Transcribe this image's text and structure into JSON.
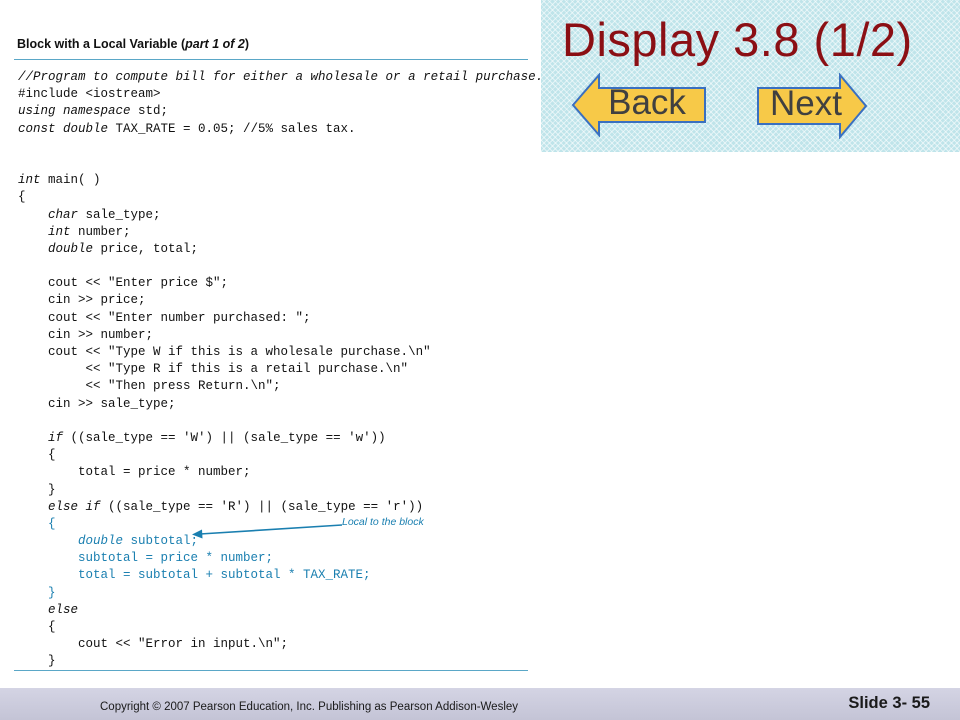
{
  "slide": {
    "title": "Display 3.8  (1/2)",
    "back_label": "Back",
    "next_label": "Next"
  },
  "panel": {
    "title": "Block with a Local Variable (",
    "title_part": "part 1 of 2",
    "title_close": ")"
  },
  "code": {
    "line01": "//Program to compute bill for either a wholesale or a retail purchase.",
    "line02": "#include <iostream>",
    "line03_kw": "using namespace",
    "line03_rest": " std;",
    "line04_kw": "const double",
    "line04_rest": " TAX_RATE = 0.05; //5% sales tax.",
    "line05": "",
    "line06": "",
    "line07_kw": "int",
    "line07_rest": " main( )",
    "line08": "{",
    "line09_pre": "    ",
    "line09_kw": "char",
    "line09_rest": " sale_type;",
    "line10_pre": "    ",
    "line10_kw": "int",
    "line10_rest": " number;",
    "line11_pre": "    ",
    "line11_kw": "double",
    "line11_rest": " price, total;",
    "line12": "",
    "line13": "    cout << \"Enter price $\";",
    "line14": "    cin >> price;",
    "line15": "    cout << \"Enter number purchased: \";",
    "line16": "    cin >> number;",
    "line17": "    cout << \"Type W if this is a wholesale purchase.\\n\"",
    "line18": "         << \"Type R if this is a retail purchase.\\n\"",
    "line19": "         << \"Then press Return.\\n\";",
    "line20": "    cin >> sale_type;",
    "line21": "",
    "line22_pre": "    ",
    "line22_kw": "if",
    "line22_rest": " ((sale_type == 'W') || (sale_type == 'w'))",
    "line23": "    {",
    "line24": "        total = price * number;",
    "line25": "    }",
    "line26_pre": "    ",
    "line26_kw": "else if",
    "line26_rest": " ((sale_type == 'R') || (sale_type == 'r'))",
    "line27": "    {",
    "line28_pre": "        ",
    "line28_kw": "double",
    "line28_rest": " subtotal;",
    "line29": "        subtotal = price * number;",
    "line30": "        total = subtotal + subtotal * TAX_RATE;",
    "line31": "    }",
    "line32_pre": "    ",
    "line32_kw": "else",
    "line33": "    {",
    "line34": "        cout << \"Error in input.\\n\";",
    "line35": "    }"
  },
  "annotation": {
    "label": "Local to the block"
  },
  "footer": {
    "copyright": "Copyright © 2007 Pearson Education, Inc. Publishing as Pearson Addison-Wesley",
    "slide_number": "Slide 3- 55"
  },
  "colors": {
    "title": "#8b0f14",
    "button_fill": "#f7c948",
    "button_stroke": "#3a70c0",
    "highlight": "#1a7fb0",
    "header_bg": "#bfe4ea",
    "footer_bg": "#c8c8da"
  }
}
